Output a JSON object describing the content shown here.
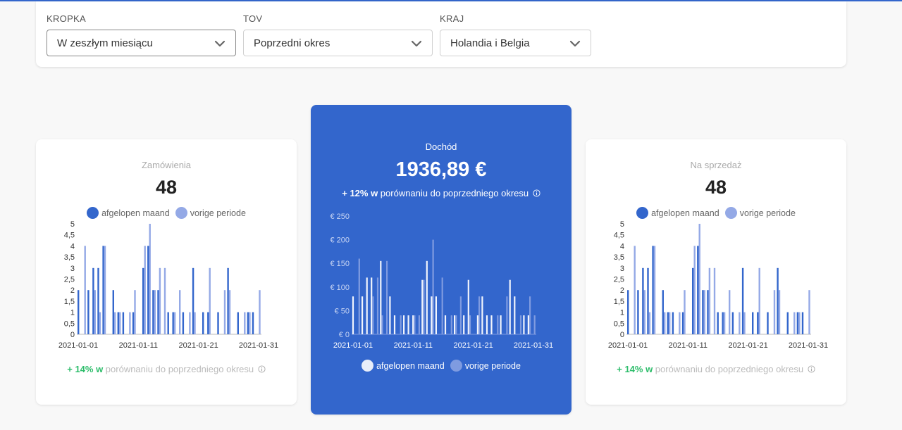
{
  "filters": [
    {
      "label": "KROPKA",
      "value": "W zeszłym miesiącu"
    },
    {
      "label": "TOV",
      "value": "Poprzedni okres"
    },
    {
      "label": "KRAJ",
      "value": "Holandia i Belgia"
    }
  ],
  "cards": {
    "orders": {
      "title": "Zamówienia",
      "value": "48",
      "change_pct": "+ 14% w",
      "change_text": " porównaniu do poprzedniego okresu"
    },
    "revenue": {
      "title": "Dochód",
      "value": "1936,89 €",
      "change_pct": "+ 12% w",
      "change_text": " porównaniu do poprzedniego okresu"
    },
    "sales": {
      "title": "Na sprzedaż",
      "value": "48",
      "change_pct": "+ 14% w",
      "change_text": " porównaniu do poprzedniego okresu"
    }
  },
  "colors": {
    "accent": "#3366cc",
    "series_current": "#3366cc",
    "series_previous": "#94a9e6",
    "positive": "#2ebd6b"
  },
  "chart_data": [
    {
      "type": "bar",
      "series": [
        {
          "name": "afgelopen maand",
          "values": [
            2,
            0,
            2,
            3,
            3,
            4,
            0,
            2,
            1,
            1,
            0,
            1,
            0,
            3,
            4,
            2,
            2,
            0,
            1,
            1,
            0,
            1,
            0,
            3,
            0,
            1,
            1,
            0,
            1,
            0,
            3,
            0,
            1,
            0,
            1,
            1,
            0
          ]
        },
        {
          "name": "vorige periode",
          "values": [
            0,
            4,
            0,
            2,
            1,
            4,
            0,
            1,
            1,
            0,
            1,
            2,
            0,
            4,
            5,
            2,
            3,
            3,
            0,
            1,
            2,
            0,
            1,
            1,
            0,
            0,
            3,
            0,
            0,
            2,
            2,
            0,
            0,
            1,
            1,
            0,
            2
          ]
        }
      ],
      "categories": [
        "2021-01-01",
        "2021-01-11",
        "2021-01-21",
        "2021-01-31"
      ],
      "ticks_y": [
        "5",
        "4,5",
        "4",
        "3,5",
        "3",
        "2,5",
        "2",
        "1,5",
        "1",
        "0,5",
        "0"
      ],
      "ylim": [
        0,
        5
      ]
    },
    {
      "type": "bar",
      "series": [
        {
          "name": "afgelopen maand",
          "values": [
            80,
            0,
            80,
            120,
            120,
            0,
            155,
            0,
            80,
            40,
            0,
            40,
            40,
            40,
            0,
            115,
            155,
            80,
            80,
            0,
            40,
            0,
            40,
            0,
            40,
            115,
            0,
            40,
            80,
            40,
            40,
            0,
            40,
            0,
            115,
            80,
            0,
            40,
            40,
            0
          ]
        },
        {
          "name": "vorige periode",
          "values": [
            0,
            160,
            0,
            0,
            80,
            120,
            40,
            155,
            0,
            0,
            40,
            0,
            0,
            40,
            40,
            115,
            0,
            200,
            0,
            120,
            0,
            40,
            40,
            80,
            0,
            40,
            0,
            80,
            0,
            0,
            0,
            40,
            0,
            80,
            0,
            0,
            40,
            0,
            80,
            40
          ]
        }
      ],
      "categories": [
        "2021-01-01",
        "2021-01-11",
        "2021-01-21",
        "2021-01-31"
      ],
      "ticks_y": [
        "€ 250",
        "€ 200",
        "€ 150",
        "€ 100",
        "€ 50",
        "€ 0"
      ],
      "ylim": [
        0,
        250
      ]
    },
    {
      "type": "bar",
      "series": [
        {
          "name": "afgelopen maand",
          "values": [
            2,
            0,
            2,
            3,
            3,
            4,
            0,
            2,
            1,
            1,
            0,
            1,
            0,
            3,
            4,
            2,
            2,
            0,
            1,
            1,
            0,
            1,
            0,
            3,
            0,
            1,
            1,
            0,
            1,
            0,
            3,
            0,
            1,
            0,
            1,
            1,
            0
          ]
        },
        {
          "name": "vorige periode",
          "values": [
            0,
            4,
            0,
            2,
            1,
            4,
            0,
            1,
            1,
            0,
            1,
            2,
            0,
            4,
            5,
            2,
            3,
            3,
            0,
            1,
            2,
            0,
            1,
            1,
            0,
            0,
            3,
            0,
            0,
            2,
            2,
            0,
            0,
            1,
            1,
            0,
            2
          ]
        }
      ],
      "categories": [
        "2021-01-01",
        "2021-01-11",
        "2021-01-21",
        "2021-01-31"
      ],
      "ticks_y": [
        "5",
        "4,5",
        "4",
        "3,5",
        "3",
        "2,5",
        "2",
        "1,5",
        "1",
        "0,5",
        "0"
      ],
      "ylim": [
        0,
        5
      ]
    }
  ]
}
